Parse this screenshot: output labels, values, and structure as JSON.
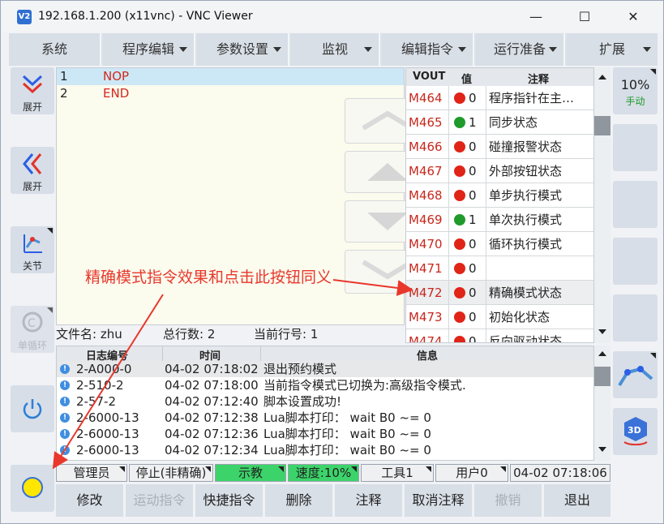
{
  "window": {
    "title": "192.168.1.200 (x11vnc) - VNC Viewer",
    "icon": "V2",
    "minimize": "—",
    "maximize": "☐",
    "close": "✕"
  },
  "menu": [
    "系统",
    "程序编辑",
    "参数设置",
    "监视",
    "编辑指令",
    "运行准备",
    "扩展"
  ],
  "left_buttons": {
    "expand1": "展开",
    "expand2": "展开",
    "joint": "关节",
    "single_cycle": "单循环"
  },
  "right_panel": {
    "speed": "10%",
    "mode": "手动"
  },
  "program": {
    "lines": [
      {
        "num": "1",
        "cmd": "NOP"
      },
      {
        "num": "2",
        "cmd": "END"
      }
    ],
    "file_name": "文件名: zhu",
    "total_lines": "总行数: 2",
    "current_line": "当前行号: 1"
  },
  "vout_table": {
    "headers": [
      "VOUT",
      "值",
      "注释"
    ],
    "rows": [
      {
        "vout": "M464",
        "state": "red",
        "val": "0",
        "note": "程序指针在主…"
      },
      {
        "vout": "M465",
        "state": "green",
        "val": "1",
        "note": "同步状态"
      },
      {
        "vout": "M466",
        "state": "red",
        "val": "0",
        "note": "碰撞报警状态"
      },
      {
        "vout": "M467",
        "state": "red",
        "val": "0",
        "note": "外部按钮状态"
      },
      {
        "vout": "M468",
        "state": "red",
        "val": "0",
        "note": "单步执行模式"
      },
      {
        "vout": "M469",
        "state": "green",
        "val": "1",
        "note": "单次执行模式"
      },
      {
        "vout": "M470",
        "state": "red",
        "val": "0",
        "note": "循环执行模式"
      },
      {
        "vout": "M471",
        "state": "red",
        "val": "0",
        "note": ""
      },
      {
        "vout": "M472",
        "state": "red",
        "val": "0",
        "note": "精确模式状态"
      },
      {
        "vout": "M473",
        "state": "red",
        "val": "0",
        "note": "初始化状态"
      },
      {
        "vout": "M474",
        "state": "red",
        "val": "0",
        "note": "反向驱动状态"
      }
    ]
  },
  "log": {
    "headers": [
      "日志编号",
      "时间",
      "信息"
    ],
    "rows": [
      {
        "id": "2-A000-0",
        "time": "04-02 07:18:02",
        "msg": "退出预约模式"
      },
      {
        "id": "2-510-2",
        "time": "04-02 07:18:00",
        "msg": "当前指令模式已切换为:高级指令模式."
      },
      {
        "id": "2-57-2",
        "time": "04-02 07:12:40",
        "msg": "脚本设置成功!"
      },
      {
        "id": "2-6000-13",
        "time": "04-02 07:12:38",
        "msg": "Lua脚本打印： wait B0 ~= 0"
      },
      {
        "id": "2-6000-13",
        "time": "04-02 07:12:36",
        "msg": "Lua脚本打印： wait B0 ~= 0"
      },
      {
        "id": "2-6000-13",
        "time": "04-02 07:12:34",
        "msg": "Lua脚本打印： wait B0 ~= 0"
      }
    ]
  },
  "status": {
    "user_role": "管理员",
    "stop_mode": "停止(非精确)",
    "teach": "示教",
    "speed": "速度:10%",
    "tool": "工具1",
    "user": "用户0",
    "datetime": "04-02 07:18:06"
  },
  "bottom_buttons": [
    "修改",
    "运动指令",
    "快捷指令",
    "删除",
    "注释",
    "取消注释",
    "撤销",
    "退出"
  ],
  "annotation": "精确模式指令效果和点击此按钮同义",
  "colors": {
    "red": "#e02417",
    "green": "#1f9a2b",
    "accent_green": "#3cd46a",
    "menu": "#d8dfe7"
  }
}
